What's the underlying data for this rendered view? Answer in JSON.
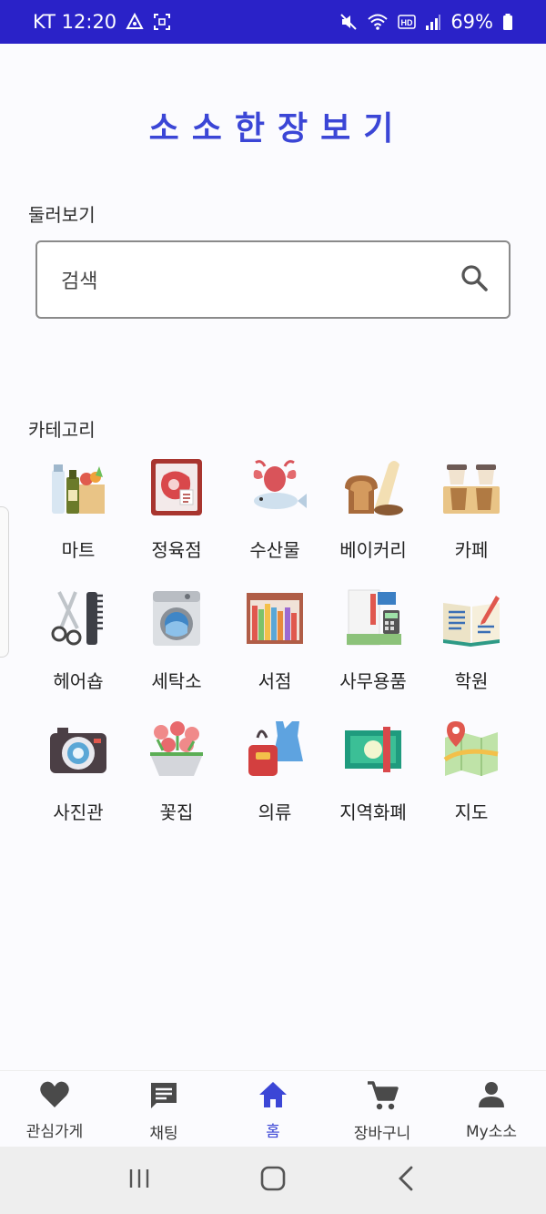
{
  "status_bar": {
    "carrier_time": "KT 12:20",
    "battery": "69%"
  },
  "app_title": "소소한장보기",
  "browse": {
    "label": "둘러보기",
    "search_placeholder": "검색"
  },
  "categories_label": "카테고리",
  "categories": [
    {
      "label": "마트",
      "icon": "mart-icon"
    },
    {
      "label": "정육점",
      "icon": "butcher-icon"
    },
    {
      "label": "수산물",
      "icon": "seafood-icon"
    },
    {
      "label": "베이커리",
      "icon": "bakery-icon"
    },
    {
      "label": "카페",
      "icon": "cafe-icon"
    },
    {
      "label": "헤어숍",
      "icon": "hair-salon-icon"
    },
    {
      "label": "세탁소",
      "icon": "laundry-icon"
    },
    {
      "label": "서점",
      "icon": "bookstore-icon"
    },
    {
      "label": "사무용품",
      "icon": "office-supplies-icon"
    },
    {
      "label": "학원",
      "icon": "academy-icon"
    },
    {
      "label": "사진관",
      "icon": "photo-studio-icon"
    },
    {
      "label": "꽃집",
      "icon": "flower-shop-icon"
    },
    {
      "label": "의류",
      "icon": "clothing-icon"
    },
    {
      "label": "지역화폐",
      "icon": "local-currency-icon"
    },
    {
      "label": "지도",
      "icon": "map-icon"
    }
  ],
  "bottom_nav": [
    {
      "label": "관심가게",
      "icon": "heart-icon"
    },
    {
      "label": "채팅",
      "icon": "chat-icon"
    },
    {
      "label": "홈",
      "icon": "home-icon"
    },
    {
      "label": "장바구니",
      "icon": "cart-icon"
    },
    {
      "label": "My소소",
      "icon": "person-icon"
    }
  ],
  "colors": {
    "accent": "#3b46d6",
    "status_bar": "#2a22c8"
  }
}
